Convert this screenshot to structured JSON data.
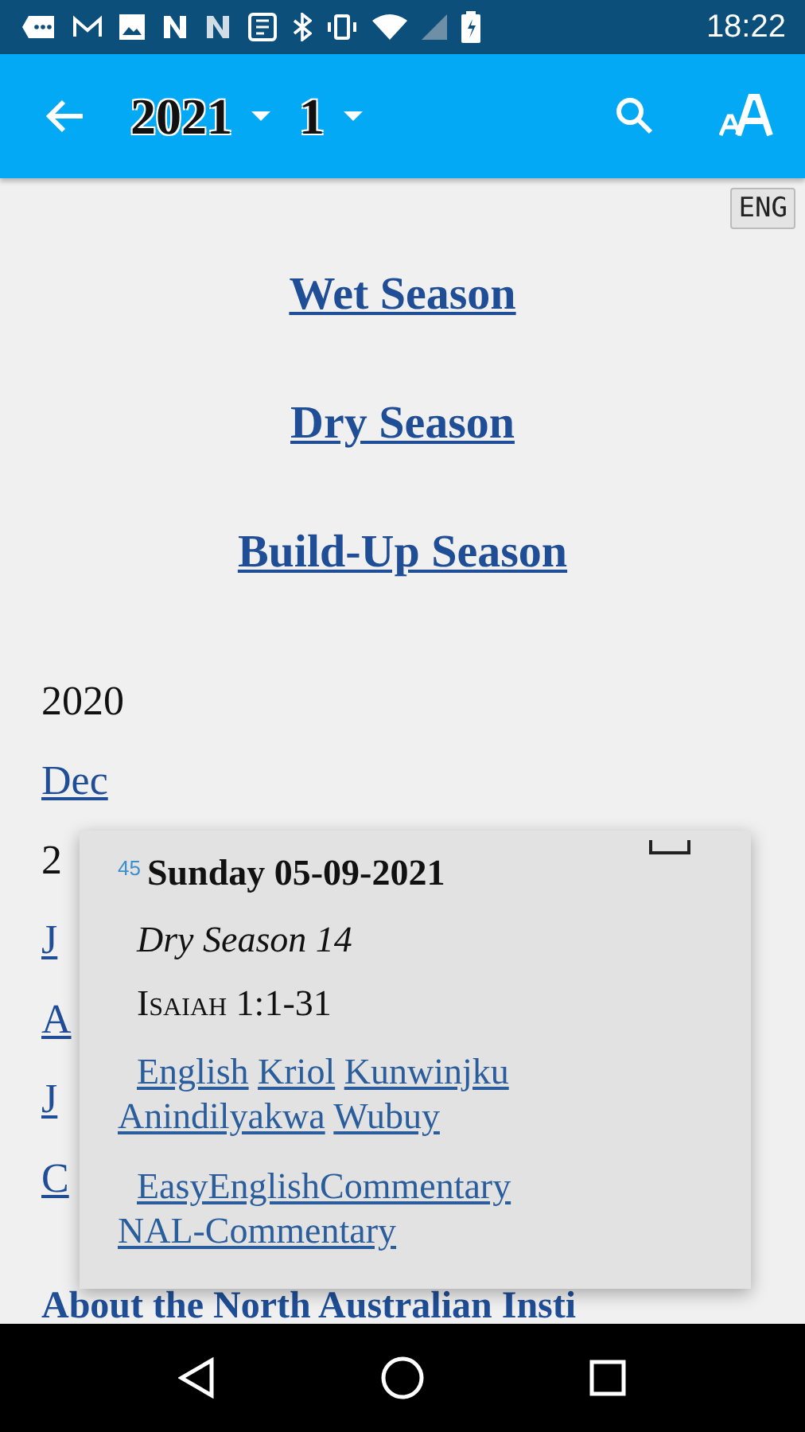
{
  "status_bar": {
    "time": "18:22"
  },
  "toolbar": {
    "year": "2021",
    "month": "1"
  },
  "language_badge": "ENG",
  "season_links": [
    "Wet Season",
    "Dry Season",
    "Build-Up Season"
  ],
  "archive": [
    {
      "kind": "year",
      "text": "2020"
    },
    {
      "kind": "link",
      "text": "Dec"
    },
    {
      "kind": "year",
      "text": "2"
    },
    {
      "kind": "link",
      "text": "J"
    },
    {
      "kind": "link",
      "text": "A"
    },
    {
      "kind": "link",
      "text": "J"
    },
    {
      "kind": "link",
      "text": "C"
    }
  ],
  "footer_heading": "About the North Australian Insti",
  "popup": {
    "number": "45",
    "date": "Sunday 05-09-2021",
    "season": "Dry Season 14",
    "reading": "Isaiah 1:1-31",
    "translations": [
      "English",
      "Kriol",
      "Kunwinjku",
      "Anindilyakwa",
      "Wubuy"
    ],
    "commentaries": [
      "EasyEnglishCommentary",
      "NAL-Commentary"
    ]
  }
}
